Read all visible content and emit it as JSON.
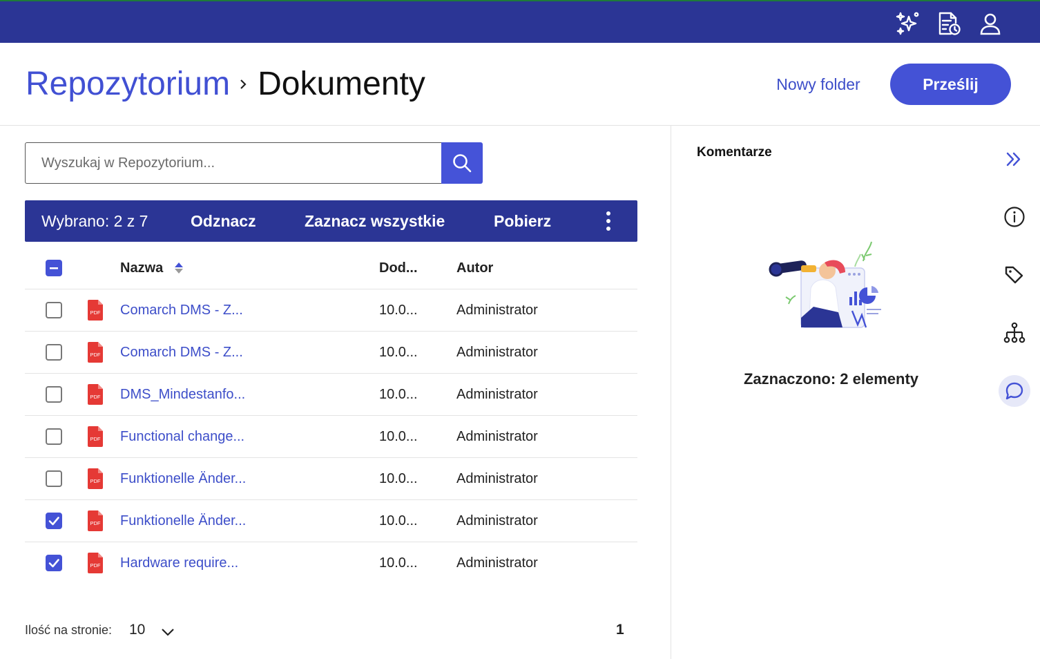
{
  "topbar": {
    "icons": [
      "sparkles-icon",
      "document-clock-icon",
      "user-icon"
    ]
  },
  "header": {
    "breadcrumb_root": "Repozytorium",
    "breadcrumb_current": "Dokumenty",
    "new_folder_label": "Nowy folder",
    "upload_label": "Prześlij"
  },
  "search": {
    "placeholder": "Wyszukaj w Repozytorium..."
  },
  "selection_bar": {
    "selected_text": "Wybrano: 2 z 7",
    "deselect_label": "Odznacz",
    "select_all_label": "Zaznacz wszystkie",
    "download_label": "Pobierz"
  },
  "table": {
    "columns": [
      "Nazwa",
      "Dod...",
      "Autor"
    ],
    "rows": [
      {
        "name": "Comarch DMS - Z...",
        "date": "10.0...",
        "author": "Administrator",
        "checked": false
      },
      {
        "name": "Comarch DMS - Z...",
        "date": "10.0...",
        "author": "Administrator",
        "checked": false
      },
      {
        "name": "DMS_Mindestanfo...",
        "date": "10.0...",
        "author": "Administrator",
        "checked": false
      },
      {
        "name": "Functional change...",
        "date": "10.0...",
        "author": "Administrator",
        "checked": false
      },
      {
        "name": "Funktionelle Änder...",
        "date": "10.0...",
        "author": "Administrator",
        "checked": false
      },
      {
        "name": "Funktionelle Änder...",
        "date": "10.0...",
        "author": "Administrator",
        "checked": true
      },
      {
        "name": "Hardware require...",
        "date": "10.0...",
        "author": "Administrator",
        "checked": true
      }
    ],
    "file_icon_label": "PDF"
  },
  "pagination": {
    "per_page_label": "Ilość na stronie:",
    "per_page_value": "10",
    "current_page": "1"
  },
  "right_panel": {
    "title": "Komentarze",
    "message": "Zaznaczono: 2 elementy",
    "side_icons": [
      "info-icon",
      "tag-icon",
      "hierarchy-icon",
      "comment-icon"
    ],
    "active_side": "comment-icon"
  },
  "colors": {
    "brand_dark": "#2b3595",
    "primary": "#4452d6",
    "link": "#3d4ec9",
    "pdf_red": "#e53935"
  }
}
